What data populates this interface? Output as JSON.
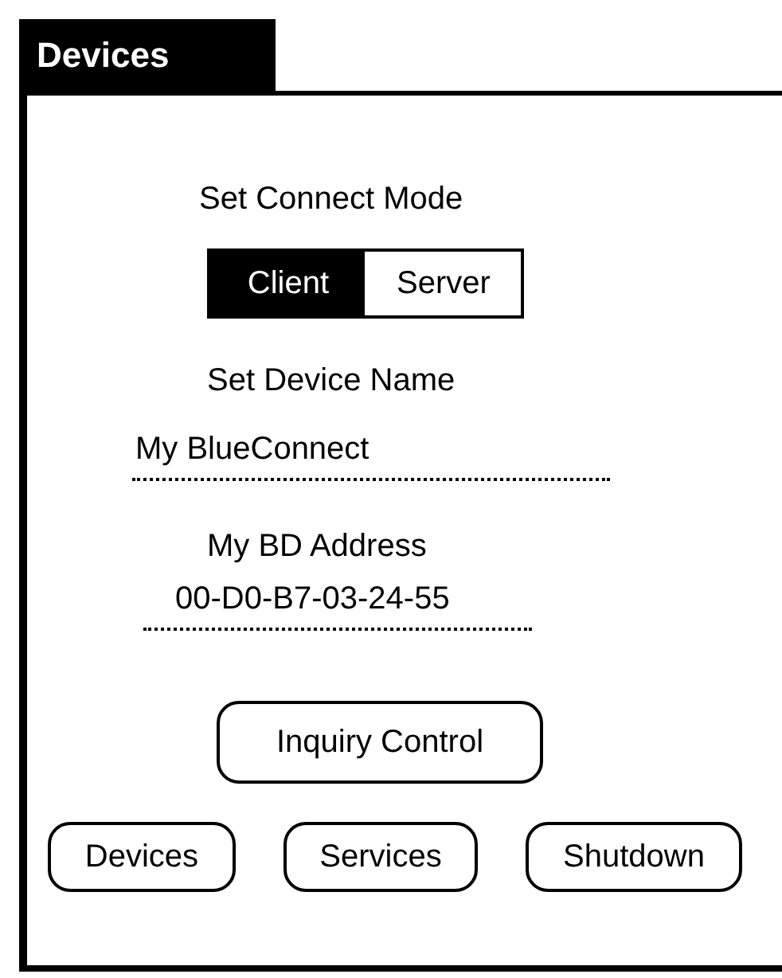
{
  "window": {
    "title": "Devices"
  },
  "connect_mode": {
    "label": "Set Connect Mode",
    "options": [
      {
        "label": "Client",
        "selected": true
      },
      {
        "label": "Server",
        "selected": false
      }
    ]
  },
  "device_name": {
    "label": "Set Device Name",
    "value": "My BlueConnect"
  },
  "bd_address": {
    "label": "My BD Address",
    "value": "00-D0-B7-03-24-55"
  },
  "inquiry_button": "Inquiry Control",
  "buttons": [
    "Devices",
    "Services",
    "Shutdown"
  ]
}
